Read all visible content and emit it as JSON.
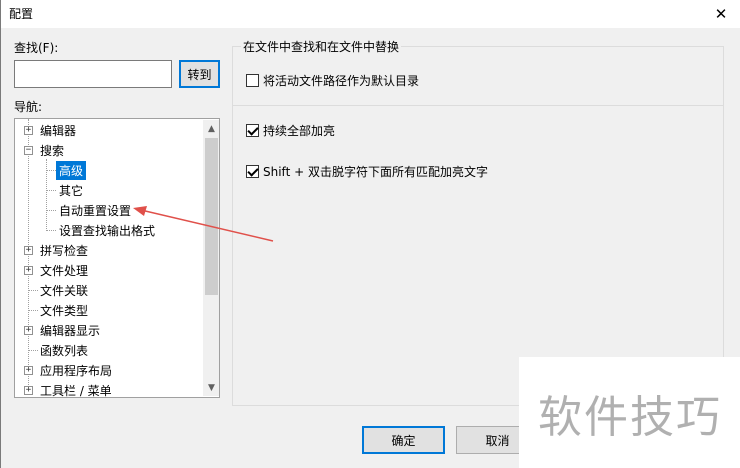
{
  "window": {
    "title": "配置",
    "close_symbol": "✕"
  },
  "find": {
    "label": "查找(F):",
    "value": "",
    "go_button": "转到"
  },
  "nav": {
    "label": "导航:",
    "items": [
      {
        "label": "编辑器",
        "expander": "+"
      },
      {
        "label": "搜索",
        "expander": "−"
      },
      {
        "label": "高级",
        "selected": true
      },
      {
        "label": "其它"
      },
      {
        "label": "自动重置设置"
      },
      {
        "label": "设置查找输出格式"
      },
      {
        "label": "拼写检查",
        "expander": "+"
      },
      {
        "label": "文件处理",
        "expander": "+"
      },
      {
        "label": "文件关联"
      },
      {
        "label": "文件类型"
      },
      {
        "label": "编辑器显示",
        "expander": "+"
      },
      {
        "label": "函数列表"
      },
      {
        "label": "应用程序布局",
        "expander": "+"
      },
      {
        "label": "工具栏 / 菜单",
        "expander": "+"
      }
    ]
  },
  "panel": {
    "group_title": "在文件中查找和在文件中替换",
    "options": [
      {
        "label": "将活动文件路径作为默认目录",
        "checked": false
      },
      {
        "label": "持续全部加亮",
        "checked": true
      },
      {
        "label": "Shift + 双击脱字符下面所有匹配加亮文字",
        "checked": true
      }
    ]
  },
  "buttons": {
    "ok": "确定",
    "cancel": "取消"
  },
  "watermark": "软件技巧",
  "colors": {
    "accent": "#0078d7",
    "annotation_arrow": "#e0504a"
  }
}
